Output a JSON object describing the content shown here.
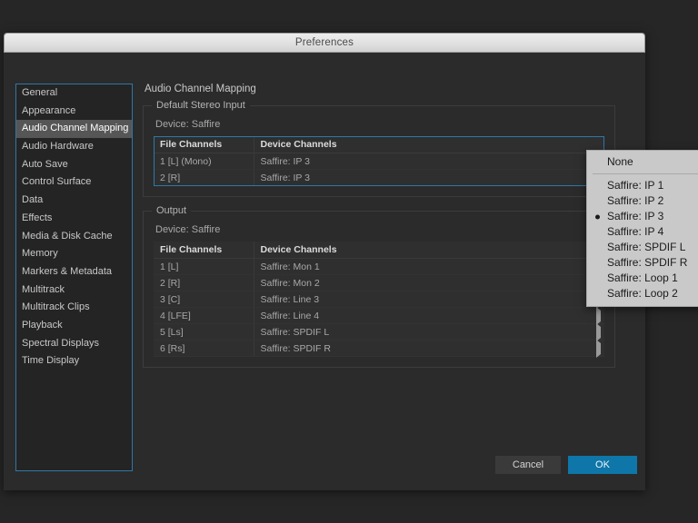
{
  "window": {
    "title": "Preferences"
  },
  "sidebar": {
    "items": [
      {
        "label": "General",
        "selected": false
      },
      {
        "label": "Appearance",
        "selected": false
      },
      {
        "label": "Audio Channel Mapping",
        "selected": true
      },
      {
        "label": "Audio Hardware",
        "selected": false
      },
      {
        "label": "Auto Save",
        "selected": false
      },
      {
        "label": "Control Surface",
        "selected": false
      },
      {
        "label": "Data",
        "selected": false
      },
      {
        "label": "Effects",
        "selected": false
      },
      {
        "label": "Media & Disk Cache",
        "selected": false
      },
      {
        "label": "Memory",
        "selected": false
      },
      {
        "label": "Markers & Metadata",
        "selected": false
      },
      {
        "label": "Multitrack",
        "selected": false
      },
      {
        "label": "Multitrack Clips",
        "selected": false
      },
      {
        "label": "Playback",
        "selected": false
      },
      {
        "label": "Spectral Displays",
        "selected": false
      },
      {
        "label": "Time Display",
        "selected": false
      }
    ]
  },
  "panel": {
    "title": "Audio Channel Mapping",
    "input_group": {
      "legend": "Default Stereo Input",
      "device": "Device: Saffire",
      "columns": [
        "File Channels",
        "Device Channels"
      ],
      "rows": [
        {
          "file": "1 [L] (Mono)",
          "device": "Saffire:  IP 3"
        },
        {
          "file": "2 [R]",
          "device": "Saffire:  IP 3"
        }
      ]
    },
    "output_group": {
      "legend": "Output",
      "device": "Device: Saffire",
      "columns": [
        "File Channels",
        "Device Channels"
      ],
      "rows": [
        {
          "file": "1 [L]",
          "device": "Saffire:  Mon 1"
        },
        {
          "file": "2 [R]",
          "device": "Saffire:  Mon 2"
        },
        {
          "file": "3 [C]",
          "device": "Saffire:  Line 3"
        },
        {
          "file": "4 [LFE]",
          "device": "Saffire:  Line 4"
        },
        {
          "file": "5 [Ls]",
          "device": "Saffire:  SPDIF L"
        },
        {
          "file": "6 [Rs]",
          "device": "Saffire:  SPDIF R"
        }
      ]
    }
  },
  "context_menu": {
    "items": [
      {
        "label": "None",
        "selected": false,
        "separator_after": true
      },
      {
        "label": "Saffire:  IP 1",
        "selected": false
      },
      {
        "label": "Saffire:  IP 2",
        "selected": false
      },
      {
        "label": "Saffire:  IP 3",
        "selected": true
      },
      {
        "label": "Saffire:  IP 4",
        "selected": false
      },
      {
        "label": "Saffire:  SPDIF L",
        "selected": false
      },
      {
        "label": "Saffire:  SPDIF R",
        "selected": false
      },
      {
        "label": "Saffire:  Loop 1",
        "selected": false
      },
      {
        "label": "Saffire:  Loop 2",
        "selected": false
      }
    ]
  },
  "footer": {
    "cancel_label": "Cancel",
    "ok_label": "OK"
  },
  "colors": {
    "accent_blue": "#0e76a8",
    "focus_border": "#2d79a6",
    "window_bg": "#2b2b2b",
    "desktop_bg": "#262626",
    "menu_bg": "#c9c9c9"
  }
}
